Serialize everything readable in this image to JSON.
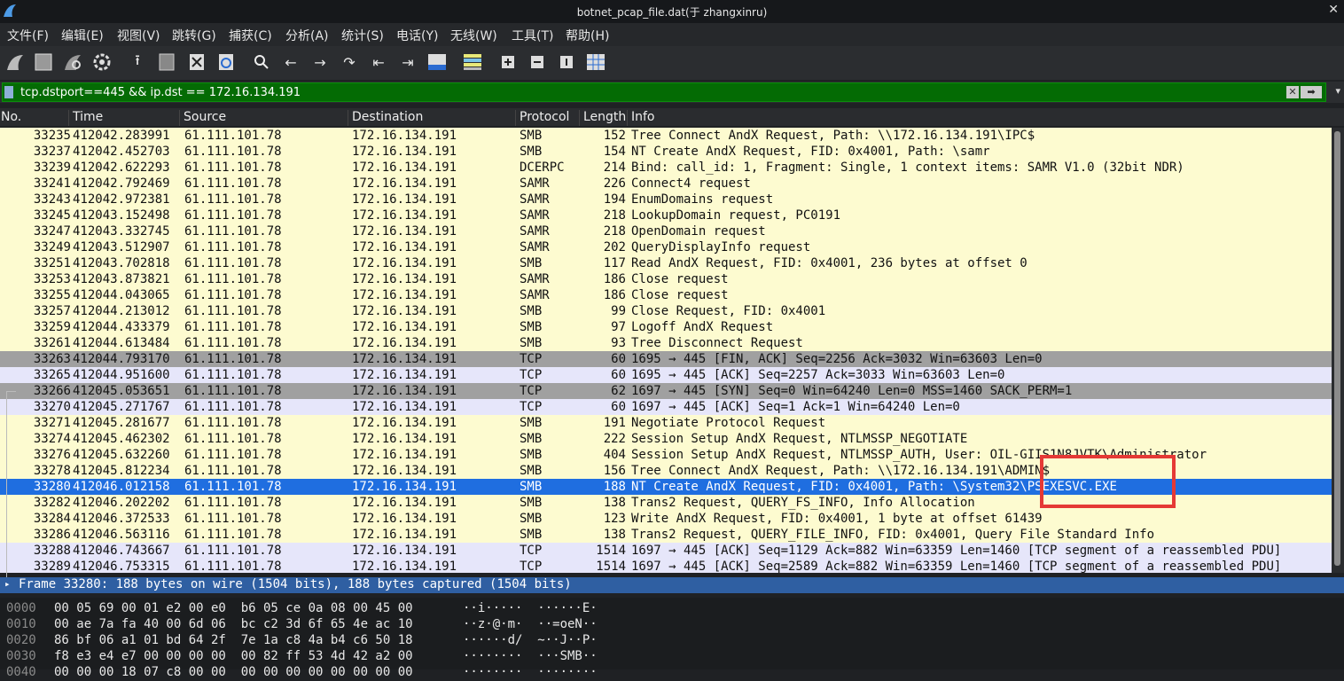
{
  "window": {
    "title": "botnet_pcap_file.dat(于 zhangxinru)"
  },
  "menu": [
    "文件(F)",
    "编辑(E)",
    "视图(V)",
    "跳转(G)",
    "捕获(C)",
    "分析(A)",
    "统计(S)",
    "电话(Y)",
    "无线(W)",
    "工具(T)",
    "帮助(H)"
  ],
  "filter": {
    "value": "tcp.dstport==445 && ip.dst == 172.16.134.191"
  },
  "columns": [
    "No.",
    "Time",
    "Source",
    "Destination",
    "Protocol",
    "Length",
    "Info"
  ],
  "colors": {
    "smb_bg": "#fdfbd0",
    "tcp_ack_bg": "#e6e6fa",
    "tcp_gray_bg": "#a0a0a0",
    "selected_bg": "#1f6ee0",
    "filter_bg": "#046b04",
    "highlight_box": "#e53935"
  },
  "packets": [
    {
      "no": "33235",
      "time": "412042.283991",
      "src": "61.111.101.78",
      "dst": "172.16.134.191",
      "proto": "SMB",
      "len": "152",
      "info": "Tree Connect AndX Request, Path: \\\\172.16.134.191\\IPC$",
      "style": "smb"
    },
    {
      "no": "33237",
      "time": "412042.452703",
      "src": "61.111.101.78",
      "dst": "172.16.134.191",
      "proto": "SMB",
      "len": "154",
      "info": "NT Create AndX Request, FID: 0x4001, Path: \\samr",
      "style": "smb"
    },
    {
      "no": "33239",
      "time": "412042.622293",
      "src": "61.111.101.78",
      "dst": "172.16.134.191",
      "proto": "DCERPC",
      "len": "214",
      "info": "Bind: call_id: 1, Fragment: Single, 1 context items: SAMR V1.0 (32bit NDR)",
      "style": "smb"
    },
    {
      "no": "33241",
      "time": "412042.792469",
      "src": "61.111.101.78",
      "dst": "172.16.134.191",
      "proto": "SAMR",
      "len": "226",
      "info": "Connect4 request",
      "style": "smb"
    },
    {
      "no": "33243",
      "time": "412042.972381",
      "src": "61.111.101.78",
      "dst": "172.16.134.191",
      "proto": "SAMR",
      "len": "194",
      "info": "EnumDomains request",
      "style": "smb"
    },
    {
      "no": "33245",
      "time": "412043.152498",
      "src": "61.111.101.78",
      "dst": "172.16.134.191",
      "proto": "SAMR",
      "len": "218",
      "info": "LookupDomain request, PC0191",
      "style": "smb"
    },
    {
      "no": "33247",
      "time": "412043.332745",
      "src": "61.111.101.78",
      "dst": "172.16.134.191",
      "proto": "SAMR",
      "len": "218",
      "info": "OpenDomain request",
      "style": "smb"
    },
    {
      "no": "33249",
      "time": "412043.512907",
      "src": "61.111.101.78",
      "dst": "172.16.134.191",
      "proto": "SAMR",
      "len": "202",
      "info": "QueryDisplayInfo request",
      "style": "smb"
    },
    {
      "no": "33251",
      "time": "412043.702818",
      "src": "61.111.101.78",
      "dst": "172.16.134.191",
      "proto": "SMB",
      "len": "117",
      "info": "Read AndX Request, FID: 0x4001, 236 bytes at offset 0",
      "style": "smb"
    },
    {
      "no": "33253",
      "time": "412043.873821",
      "src": "61.111.101.78",
      "dst": "172.16.134.191",
      "proto": "SAMR",
      "len": "186",
      "info": "Close request",
      "style": "smb"
    },
    {
      "no": "33255",
      "time": "412044.043065",
      "src": "61.111.101.78",
      "dst": "172.16.134.191",
      "proto": "SAMR",
      "len": "186",
      "info": "Close request",
      "style": "smb"
    },
    {
      "no": "33257",
      "time": "412044.213012",
      "src": "61.111.101.78",
      "dst": "172.16.134.191",
      "proto": "SMB",
      "len": "99",
      "info": "Close Request, FID: 0x4001",
      "style": "smb"
    },
    {
      "no": "33259",
      "time": "412044.433379",
      "src": "61.111.101.78",
      "dst": "172.16.134.191",
      "proto": "SMB",
      "len": "97",
      "info": "Logoff AndX Request",
      "style": "smb"
    },
    {
      "no": "33261",
      "time": "412044.613484",
      "src": "61.111.101.78",
      "dst": "172.16.134.191",
      "proto": "SMB",
      "len": "93",
      "info": "Tree Disconnect Request",
      "style": "smb"
    },
    {
      "no": "33263",
      "time": "412044.793170",
      "src": "61.111.101.78",
      "dst": "172.16.134.191",
      "proto": "TCP",
      "len": "60",
      "info": "1695 → 445 [FIN, ACK] Seq=2256 Ack=3032 Win=63603 Len=0",
      "style": "gray"
    },
    {
      "no": "33265",
      "time": "412044.951600",
      "src": "61.111.101.78",
      "dst": "172.16.134.191",
      "proto": "TCP",
      "len": "60",
      "info": "1695 → 445 [ACK] Seq=2257 Ack=3033 Win=63603 Len=0",
      "style": "tcp"
    },
    {
      "no": "33266",
      "time": "412045.053651",
      "src": "61.111.101.78",
      "dst": "172.16.134.191",
      "proto": "TCP",
      "len": "62",
      "info": "1697 → 445 [SYN] Seq=0 Win=64240 Len=0 MSS=1460 SACK_PERM=1",
      "style": "gray"
    },
    {
      "no": "33270",
      "time": "412045.271767",
      "src": "61.111.101.78",
      "dst": "172.16.134.191",
      "proto": "TCP",
      "len": "60",
      "info": "1697 → 445 [ACK] Seq=1 Ack=1 Win=64240 Len=0",
      "style": "tcp"
    },
    {
      "no": "33271",
      "time": "412045.281677",
      "src": "61.111.101.78",
      "dst": "172.16.134.191",
      "proto": "SMB",
      "len": "191",
      "info": "Negotiate Protocol Request",
      "style": "smb"
    },
    {
      "no": "33274",
      "time": "412045.462302",
      "src": "61.111.101.78",
      "dst": "172.16.134.191",
      "proto": "SMB",
      "len": "222",
      "info": "Session Setup AndX Request, NTLMSSP_NEGOTIATE",
      "style": "smb"
    },
    {
      "no": "33276",
      "time": "412045.632260",
      "src": "61.111.101.78",
      "dst": "172.16.134.191",
      "proto": "SMB",
      "len": "404",
      "info": "Session Setup AndX Request, NTLMSSP_AUTH, User: OIL-GIIS1N8JVTK\\Administrator",
      "style": "smb"
    },
    {
      "no": "33278",
      "time": "412045.812234",
      "src": "61.111.101.78",
      "dst": "172.16.134.191",
      "proto": "SMB",
      "len": "156",
      "info": "Tree Connect AndX Request, Path: \\\\172.16.134.191\\ADMIN$",
      "style": "smb"
    },
    {
      "no": "33280",
      "time": "412046.012158",
      "src": "61.111.101.78",
      "dst": "172.16.134.191",
      "proto": "SMB",
      "len": "188",
      "info": "NT Create AndX Request, FID: 0x4001, Path: \\System32\\PSEXESVC.EXE",
      "style": "selected"
    },
    {
      "no": "33282",
      "time": "412046.202202",
      "src": "61.111.101.78",
      "dst": "172.16.134.191",
      "proto": "SMB",
      "len": "138",
      "info": "Trans2 Request, QUERY_FS_INFO, Info Allocation",
      "style": "smb"
    },
    {
      "no": "33284",
      "time": "412046.372533",
      "src": "61.111.101.78",
      "dst": "172.16.134.191",
      "proto": "SMB",
      "len": "123",
      "info": "Write AndX Request, FID: 0x4001, 1 byte at offset 61439",
      "style": "smb"
    },
    {
      "no": "33286",
      "time": "412046.563116",
      "src": "61.111.101.78",
      "dst": "172.16.134.191",
      "proto": "SMB",
      "len": "138",
      "info": "Trans2 Request, QUERY_FILE_INFO, FID: 0x4001, Query File Standard Info",
      "style": "smb"
    },
    {
      "no": "33288",
      "time": "412046.743667",
      "src": "61.111.101.78",
      "dst": "172.16.134.191",
      "proto": "TCP",
      "len": "1514",
      "info": "1697 → 445 [ACK] Seq=1129 Ack=882 Win=63359 Len=1460 [TCP segment of a reassembled PDU]",
      "style": "tcp"
    },
    {
      "no": "33289",
      "time": "412046.753315",
      "src": "61.111.101.78",
      "dst": "172.16.134.191",
      "proto": "TCP",
      "len": "1514",
      "info": "1697 → 445 [ACK] Seq=2589 Ack=882 Win=63359 Len=1460 [TCP segment of a reassembled PDU]",
      "style": "tcp"
    }
  ],
  "detail": {
    "summary": "Frame 33280: 188 bytes on wire (1504 bits), 188 bytes captured (1504 bits)"
  },
  "bytes": [
    {
      "off": "0000",
      "hex": "00 05 69 00 01 e2 00 e0  b6 05 ce 0a 08 00 45 00",
      "ascii": "··i·····  ······E·"
    },
    {
      "off": "0010",
      "hex": "00 ae 7a fa 40 00 6d 06  bc c2 3d 6f 65 4e ac 10",
      "ascii": "··z·@·m·  ··=oeN··"
    },
    {
      "off": "0020",
      "hex": "86 bf 06 a1 01 bd 64 2f  7e 1a c8 4a b4 c6 50 18",
      "ascii": "······d/  ~··J··P·"
    },
    {
      "off": "0030",
      "hex": "f8 e3 e4 e7 00 00 00 00  00 82 ff 53 4d 42 a2 00",
      "ascii": "········  ···SMB··"
    },
    {
      "off": "0040",
      "hex": "00 00 00 18 07 c8 00 00  00 00 00 00 00 00 00 00",
      "ascii": "········  ········"
    }
  ],
  "icons": [
    "shark-fin-start-icon",
    "stop-icon",
    "restart-icon",
    "options-gear-icon",
    "open-icon",
    "file-icon",
    "close-file-icon",
    "reload-icon",
    "search-icon",
    "back-arrow-icon",
    "forward-arrow-icon",
    "jump-icon",
    "first-packet-icon",
    "last-packet-icon",
    "autoscroll-icon",
    "colorize-icon",
    "zoom-in-icon",
    "zoom-out-icon",
    "normal-size-icon",
    "resize-columns-icon"
  ]
}
